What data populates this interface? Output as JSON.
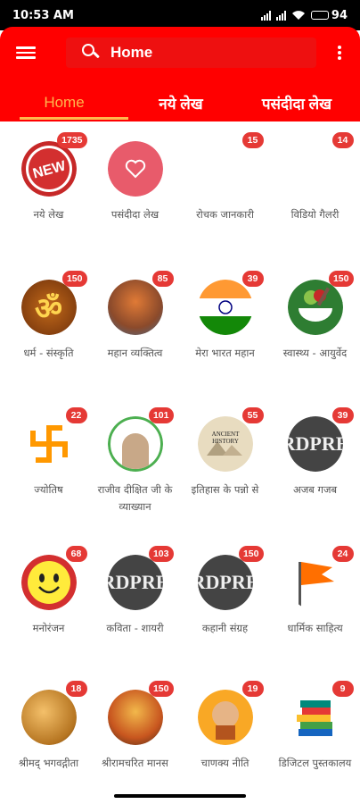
{
  "status_bar": {
    "time": "10:53 AM",
    "battery": "94"
  },
  "app_bar": {
    "menu_icon": "hamburger-menu-icon",
    "search_text": "Home",
    "more_icon": "vertical-dots-icon",
    "bg_color": "#ff0000",
    "accent_color": "#ffb74d"
  },
  "tabs": [
    {
      "label": "Home",
      "active": true
    },
    {
      "label": "नये लेख",
      "active": false
    },
    {
      "label": "पसंदीदा लेख",
      "active": false
    }
  ],
  "grid": {
    "items": [
      {
        "label": "नये लेख",
        "badge": "1735",
        "icon": "new-label-icon"
      },
      {
        "label": "पसंदीदा लेख",
        "badge": "",
        "icon": "heart-icon"
      },
      {
        "label": "रोचक जानकारी",
        "badge": "15",
        "icon": "blank-icon"
      },
      {
        "label": "विडियो गैलरी",
        "badge": "14",
        "icon": "blank-icon"
      },
      {
        "label": "धर्म - संस्कृति",
        "badge": "150",
        "icon": "om-icon"
      },
      {
        "label": "महान व्यक्तित्व",
        "badge": "85",
        "icon": "sage-portrait-icon"
      },
      {
        "label": "मेरा भारत महान",
        "badge": "39",
        "icon": "india-flag-icon"
      },
      {
        "label": "स्वास्थ्य - आयुर्वेद",
        "badge": "150",
        "icon": "mortar-pestle-icon"
      },
      {
        "label": "ज्योतिष",
        "badge": "22",
        "icon": "swastika-icon"
      },
      {
        "label": "राजीव दीक्षित जी के व्याख्यान",
        "badge": "101",
        "icon": "speaker-portrait-icon"
      },
      {
        "label": "इतिहास के पन्नो से",
        "badge": "55",
        "icon": "ancient-history-icon"
      },
      {
        "label": "अजब गजब",
        "badge": "39",
        "icon": "placeholder-text-icon"
      },
      {
        "label": "मनोरंजन",
        "badge": "68",
        "icon": "smiley-icon"
      },
      {
        "label": "कविता - शायरी",
        "badge": "103",
        "icon": "placeholder-text-icon"
      },
      {
        "label": "कहानी संग्रह",
        "badge": "150",
        "icon": "placeholder-text-icon"
      },
      {
        "label": "धार्मिक साहित्य",
        "badge": "24",
        "icon": "saffron-flag-icon"
      },
      {
        "label": "श्रीमद् भगवद्गीता",
        "badge": "18",
        "icon": "gita-chariot-icon"
      },
      {
        "label": "श्रीरामचरित मानस",
        "badge": "150",
        "icon": "ram-darbar-icon"
      },
      {
        "label": "चाणक्य नीति",
        "badge": "19",
        "icon": "chanakya-portrait-icon"
      },
      {
        "label": "डिजिटल पुस्तकालय",
        "badge": "9",
        "icon": "books-stack-icon"
      }
    ],
    "placeholder_text": "RDPRE",
    "new_text": "NEW"
  }
}
